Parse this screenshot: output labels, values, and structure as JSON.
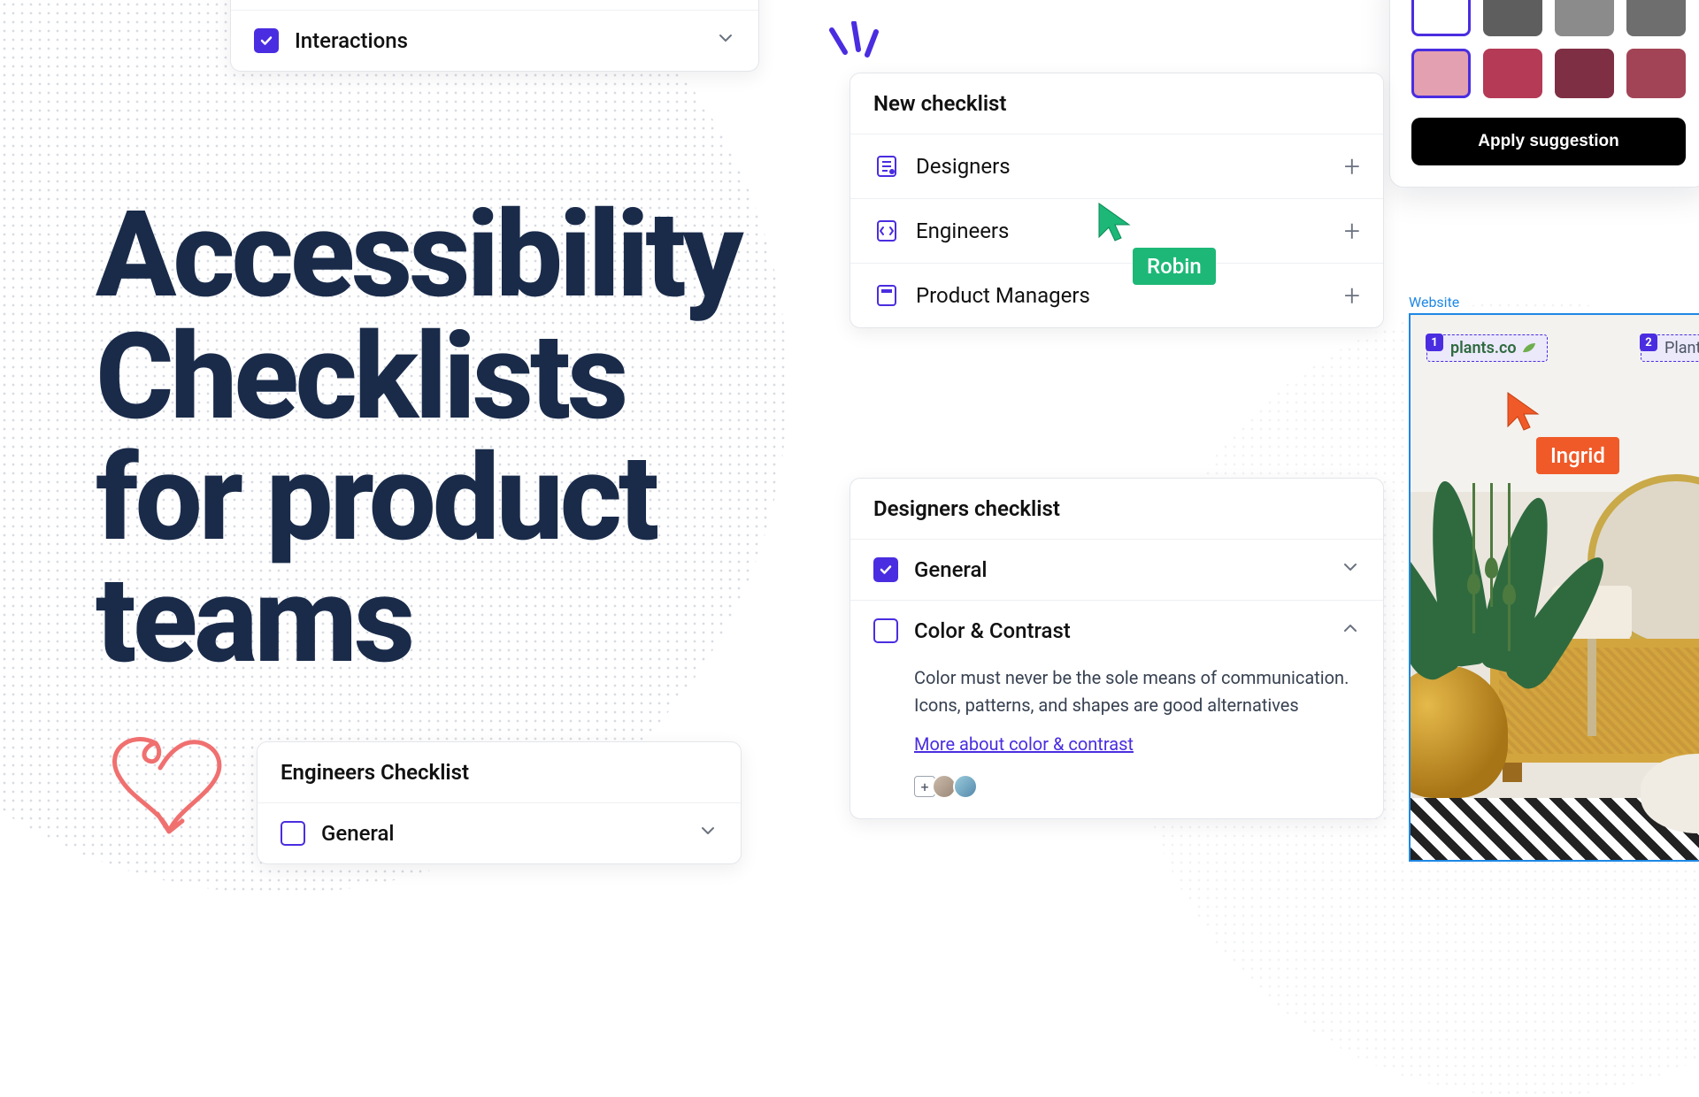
{
  "hero": {
    "line1": "Accessibility",
    "line2": "Checklists",
    "line3": "for product",
    "line4": "teams"
  },
  "interactions_card": {
    "label": "Interactions"
  },
  "engineers_card": {
    "title": "Engineers Checklist",
    "item1": "General"
  },
  "new_checklist": {
    "title": "New checklist",
    "role1": "Designers",
    "role2": "Engineers",
    "role3": "Product Managers"
  },
  "designers_checklist": {
    "title": "Designers checklist",
    "item1": "General",
    "item2": "Color & Contrast",
    "item2_desc": "Color must never be the sole means of communication. Icons, patterns, and shapes are good alternatives",
    "item2_link": "More about color & contrast"
  },
  "swatch_panel": {
    "apply": "Apply suggestion",
    "colors_row1": [
      "#ffffff",
      "#5e5e5e",
      "#8b8b8b",
      "#6e6e6e"
    ],
    "colors_row2": [
      "#e3a0b0",
      "#b43a56",
      "#7f2f44",
      "#a34456"
    ]
  },
  "website_frame": {
    "label": "Website",
    "tab1_num": "1",
    "tab1_text": "plants.co",
    "tab2_num": "2",
    "tab2_text": "Plants"
  },
  "cursors": {
    "robin": "Robin",
    "ingrid": "Ingrid"
  }
}
